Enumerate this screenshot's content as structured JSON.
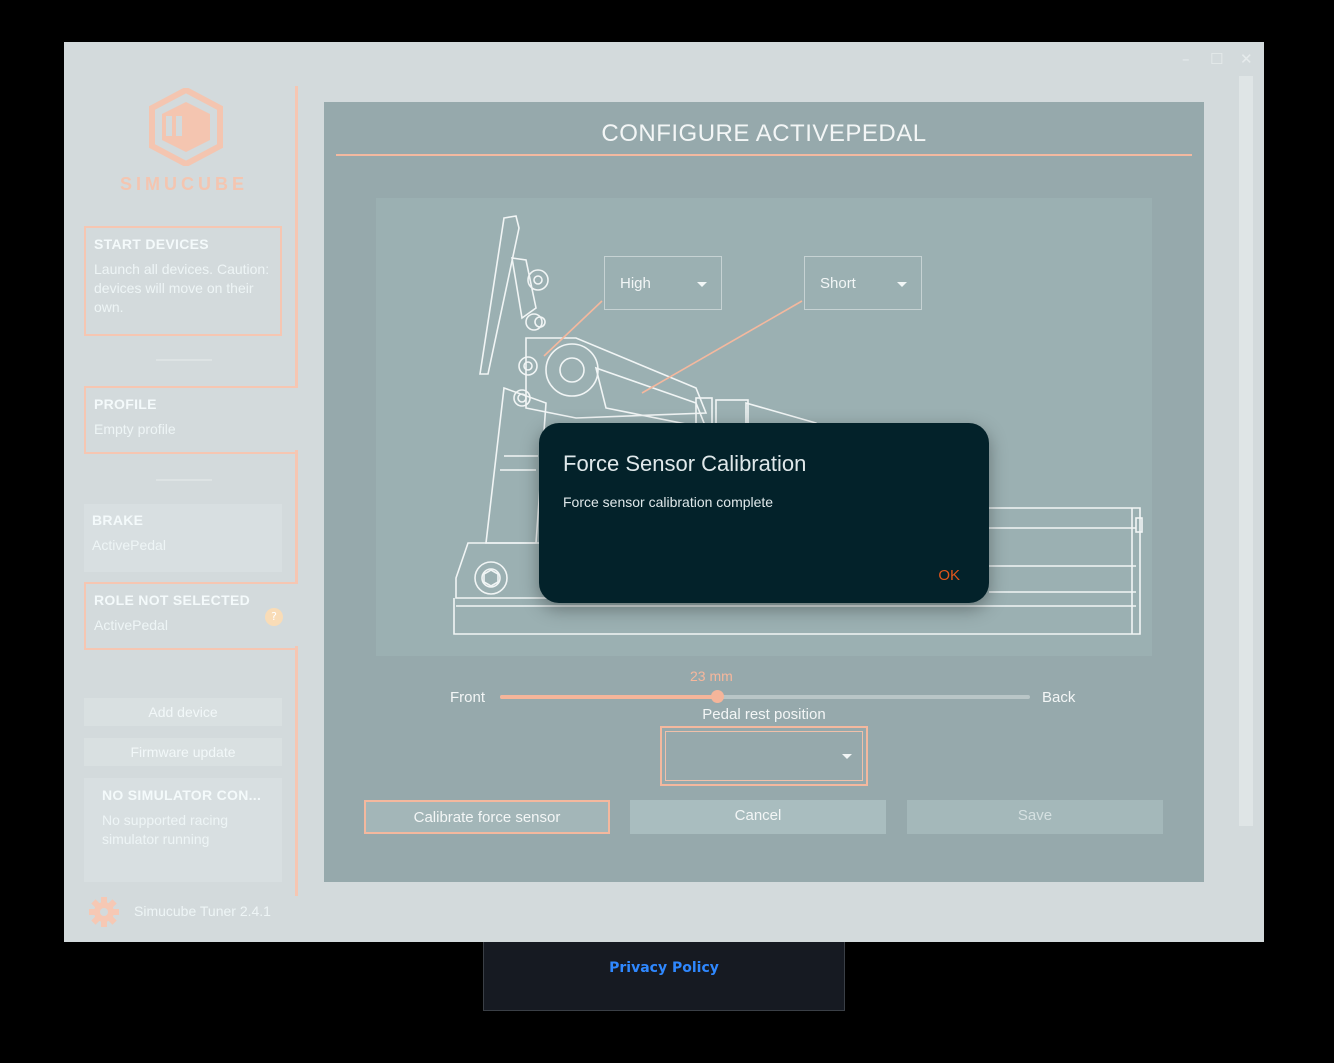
{
  "window": {
    "minimize": "–",
    "maximize": "☐",
    "close": "✕"
  },
  "brand": {
    "name": "SIMUCUBE"
  },
  "sidebar": {
    "start_devices": {
      "title": "START DEVICES",
      "desc": "Launch all devices. Caution: devices will move on their own."
    },
    "profile": {
      "title": "PROFILE",
      "value": "Empty profile"
    },
    "brake": {
      "title": "BRAKE",
      "value": "ActivePedal"
    },
    "role": {
      "title": "ROLE NOT SELECTED",
      "value": "ActivePedal",
      "badge": "?"
    },
    "add_device": "Add device",
    "firmware_update": "Firmware update",
    "simulator": {
      "title": "NO SIMULATOR CON...",
      "desc": "No supported racing simulator running"
    },
    "version": "Simucube Tuner 2.4.1"
  },
  "configure": {
    "title": "CONFIGURE ACTIVEPEDAL",
    "dropdown_height": "High",
    "dropdown_length": "Short",
    "slider": {
      "value_label": "23 mm",
      "front": "Front",
      "back": "Back",
      "fraction": 0.41
    },
    "rest_position_label": "Pedal rest position",
    "rest_position_value": "",
    "buttons": {
      "calibrate": "Calibrate force sensor",
      "cancel": "Cancel",
      "save": "Save"
    }
  },
  "modal": {
    "title": "Force Sensor Calibration",
    "message": "Force sensor calibration complete",
    "ok": "OK"
  },
  "footer": {
    "privacy_policy": "Privacy Policy"
  },
  "colors": {
    "accent": "#f4b89e",
    "modal_bg": "#03222a",
    "ok": "#e2551b",
    "link": "#2f88ff"
  }
}
